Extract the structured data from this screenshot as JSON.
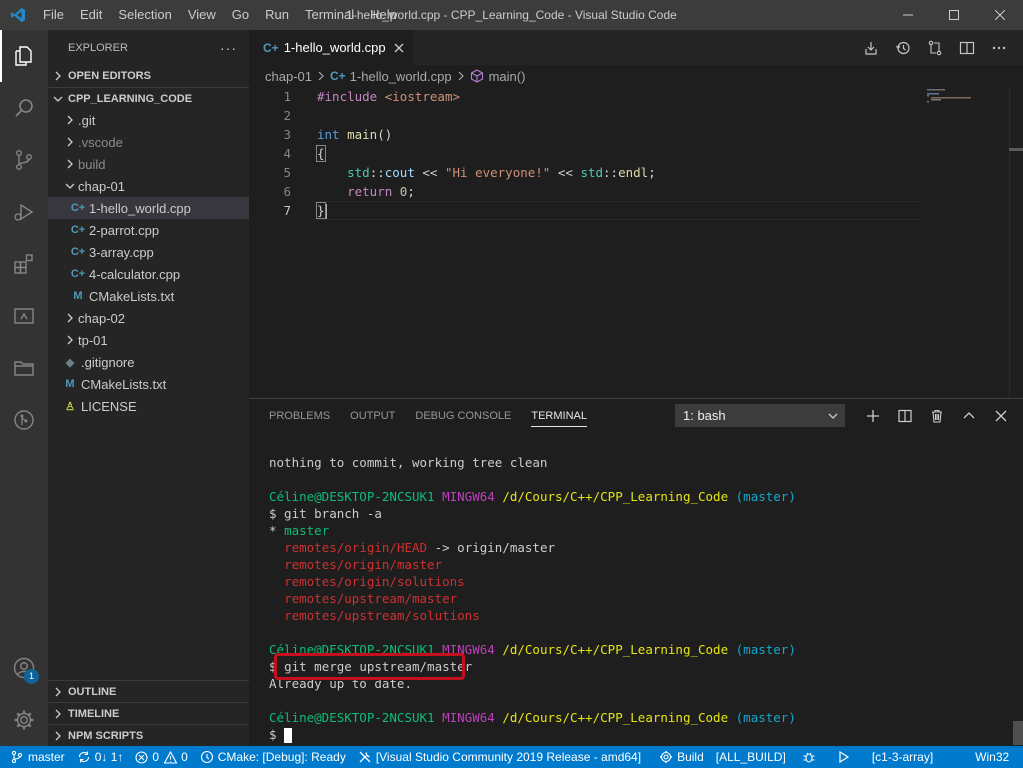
{
  "titlebar": {
    "menu": [
      "File",
      "Edit",
      "Selection",
      "View",
      "Go",
      "Run",
      "Terminal",
      "Help"
    ],
    "window_title": "1-hello_world.cpp - CPP_Learning_Code - Visual Studio Code"
  },
  "sidebar": {
    "title": "EXPLORER",
    "open_editors": "OPEN EDITORS",
    "workspace": "CPP_LEARNING_CODE",
    "items": [
      {
        "label": ".git",
        "kind": "folder",
        "depth": 1
      },
      {
        "label": ".vscode",
        "kind": "folder",
        "depth": 1,
        "dim": true
      },
      {
        "label": "build",
        "kind": "folder",
        "depth": 1,
        "dim": true
      },
      {
        "label": "chap-01",
        "kind": "folder-open",
        "depth": 1
      },
      {
        "label": "1-hello_world.cpp",
        "kind": "cpp",
        "depth": 2,
        "selected": true
      },
      {
        "label": "2-parrot.cpp",
        "kind": "cpp",
        "depth": 2
      },
      {
        "label": "3-array.cpp",
        "kind": "cpp",
        "depth": 2
      },
      {
        "label": "4-calculator.cpp",
        "kind": "cpp",
        "depth": 2
      },
      {
        "label": "CMakeLists.txt",
        "kind": "cmake",
        "depth": 2
      },
      {
        "label": "chap-02",
        "kind": "folder",
        "depth": 1
      },
      {
        "label": "tp-01",
        "kind": "folder",
        "depth": 1
      },
      {
        "label": ".gitignore",
        "kind": "git",
        "depth": 1
      },
      {
        "label": "CMakeLists.txt",
        "kind": "cmake",
        "depth": 1
      },
      {
        "label": "LICENSE",
        "kind": "license",
        "depth": 1
      }
    ],
    "outline": "OUTLINE",
    "timeline": "TIMELINE",
    "npm_scripts": "NPM SCRIPTS"
  },
  "editor": {
    "tab_label": "1-hello_world.cpp",
    "breadcrumb": {
      "folder": "chap-01",
      "file": "1-hello_world.cpp",
      "symbol": "main()"
    },
    "line_numbers": [
      "1",
      "2",
      "3",
      "4",
      "5",
      "6",
      "7"
    ],
    "code": {
      "l1_directive": "#include",
      "l1_header": " <iostream>",
      "l3_type": "int",
      "l3_func": " main",
      "l3_rest": "()",
      "l4": "{",
      "l5_ns1": "std",
      "l5_sep1": "::",
      "l5_cout": "cout",
      "l5_op1": " << ",
      "l5_string": "\"Hi everyone!\"",
      "l5_op2": " << ",
      "l5_ns2": "std",
      "l5_sep2": "::",
      "l5_endl": "endl",
      "l5_end": ";",
      "l6_kw": "return",
      "l6_num": " 0",
      "l6_end": ";",
      "l7": "}"
    }
  },
  "panel": {
    "tabs": [
      "PROBLEMS",
      "OUTPUT",
      "DEBUG CONSOLE",
      "TERMINAL"
    ],
    "terminal_select": "1: bash",
    "terminal": {
      "status_line": "nothing to commit, working tree clean",
      "prompt_user": "Céline@DESKTOP-2NCSUK1",
      "prompt_env": "MINGW64",
      "prompt_path": "/d/Cours/C++/CPP_Learning_Code",
      "prompt_branch": "(master)",
      "cmd1": "$ git branch -a",
      "current_branch_marker": "* ",
      "current_branch": "master",
      "remote_head": "remotes/origin/HEAD",
      "remote_head_target": " -> origin/master",
      "remote_branches": [
        "remotes/origin/master",
        "remotes/origin/solutions",
        "remotes/upstream/master",
        "remotes/upstream/solutions"
      ],
      "cmd2_prompt": "$ ",
      "cmd2": "git merge upstream/master",
      "cmd2_output": "Already up to date.",
      "final_prompt": "$ "
    }
  },
  "statusbar": {
    "branch": "master",
    "sync": "0↓ 1↑",
    "errors": "0",
    "warnings": "0",
    "cmake": "CMake: [Debug]: Ready",
    "kit": "[Visual Studio Community 2019 Release - amd64]",
    "build": "Build",
    "target": "[ALL_BUILD]",
    "launch_target": "[c1-3-array]",
    "platform": "Win32"
  },
  "activity": {
    "accounts_badge": "1"
  },
  "colors": {
    "statusbar": "#007acc",
    "activitybar": "#333333",
    "sidebar": "#252526",
    "editor": "#1e1e1e",
    "highlight_box": "#c50f1f"
  }
}
